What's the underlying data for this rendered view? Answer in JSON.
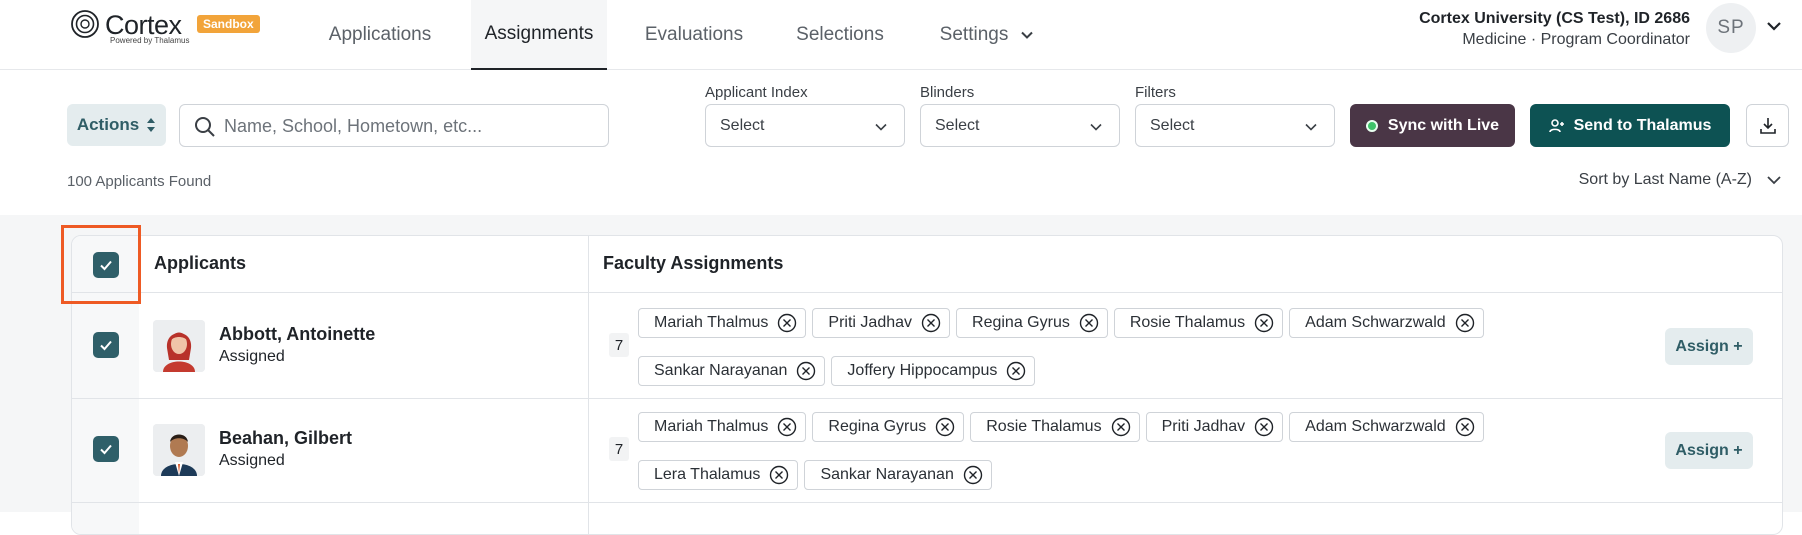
{
  "brand": {
    "name": "Cortex",
    "badge": "Sandbox",
    "tagline": "Powered by Thalamus"
  },
  "nav": {
    "tabs": [
      {
        "label": "Applications",
        "active": false
      },
      {
        "label": "Assignments",
        "active": true
      },
      {
        "label": "Evaluations",
        "active": false
      },
      {
        "label": "Selections",
        "active": false
      },
      {
        "label": "Settings",
        "active": false
      }
    ]
  },
  "account": {
    "org": "Cortex University (CS Test), ID 2686",
    "role": "Medicine · Program Coordinator",
    "initials": "SP"
  },
  "toolbar": {
    "actions_label": "Actions",
    "search_placeholder": "Name, School, Hometown, etc...",
    "filters": [
      {
        "label": "Applicant Index",
        "value": "Select"
      },
      {
        "label": "Blinders",
        "value": "Select"
      },
      {
        "label": "Filters",
        "value": "Select"
      }
    ],
    "sync_label": "Sync with Live",
    "send_label": "Send to Thalamus"
  },
  "results": {
    "count_text": "100 Applicants Found",
    "sort_label": "Sort by Last Name (A-Z)"
  },
  "table": {
    "headers": {
      "applicants": "Applicants",
      "faculty": "Faculty Assignments"
    },
    "rows": [
      {
        "name": "Abbott, Antoinette",
        "status": "Assigned",
        "count": "7",
        "assign_label": "Assign +",
        "faculty": [
          "Mariah Thalmus",
          "Priti Jadhav",
          "Regina Gyrus",
          "Rosie Thalamus",
          "Adam Schwarzwald",
          "Sankar Narayanan",
          "Joffery Hippocampus"
        ]
      },
      {
        "name": "Beahan, Gilbert",
        "status": "Assigned",
        "count": "7",
        "assign_label": "Assign +",
        "faculty": [
          "Mariah Thalmus",
          "Regina Gyrus",
          "Rosie Thalamus",
          "Priti Jadhav",
          "Adam Schwarzwald",
          "Lera Thalamus",
          "Sankar Narayanan"
        ]
      }
    ]
  },
  "colors": {
    "primary": "#0d5253",
    "sync": "#4a3646",
    "checkbox": "#2f5f69",
    "highlight": "#ee5a24",
    "badge": "#f2a43a"
  }
}
